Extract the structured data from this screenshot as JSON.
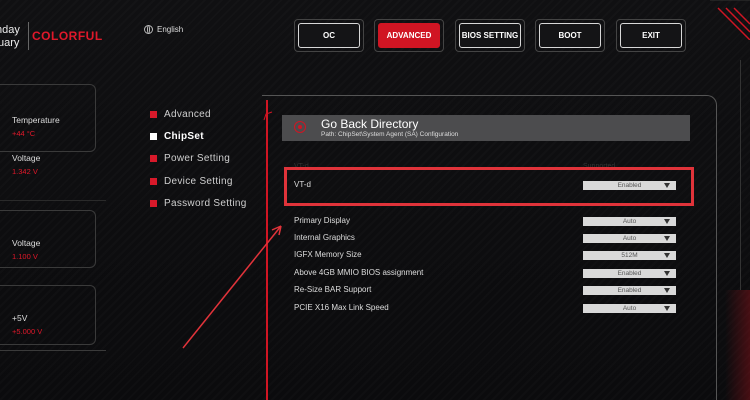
{
  "brand": {
    "line1": "nday",
    "line2": "uary",
    "logo": "COLORFUL"
  },
  "language": {
    "label": "English",
    "icon": "globe-icon"
  },
  "nav": {
    "items": [
      "OC",
      "ADVANCED",
      "BIOS SETTING",
      "BOOT",
      "EXIT"
    ],
    "active": "ADVANCED"
  },
  "sensors": [
    {
      "label": "Temperature",
      "value": "+44 °C"
    },
    {
      "label": "Voltage",
      "value": "1.342 V"
    },
    {
      "label": "Voltage",
      "value": "1.100 V"
    },
    {
      "label": "+5V",
      "value": "+5.000 V"
    }
  ],
  "menu": [
    "Advanced",
    "ChipSet",
    "Power Setting",
    "Device Setting",
    "Password Setting"
  ],
  "menu_active": "ChipSet",
  "panel": {
    "title": "Go Back Directory",
    "path": "Path: ChipSet\\System Agent (SA) Configuration",
    "faint_left": "VT-d",
    "faint_right": "Supported"
  },
  "settings": [
    {
      "name": "VT-d",
      "value": "Enabled"
    },
    {
      "name": "Primary Display",
      "value": "Auto"
    },
    {
      "name": "Internal Graphics",
      "value": "Auto"
    },
    {
      "name": "IGFX Memory Size",
      "value": "512M"
    },
    {
      "name": "Above 4GB MMIO BIOS assignment",
      "value": "Enabled"
    },
    {
      "name": "Re-Size BAR Support",
      "value": "Enabled"
    },
    {
      "name": "PCIE X16 Max Link Speed",
      "value": "Auto"
    }
  ],
  "colors": {
    "accent": "#d01523",
    "highlight": "#e0333a",
    "background": "#0d0d0f"
  }
}
